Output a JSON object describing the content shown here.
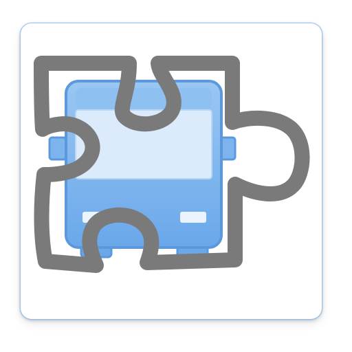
{
  "icon": {
    "name": "bus-puzzle-piece-icon",
    "colors": {
      "tile_bg": "#ffffff",
      "tile_border": "#8ec0f0",
      "bus_body": "#7db4ee",
      "bus_body_light": "#a9cdf5",
      "bus_window": "#dcebfc",
      "bus_outline": "#5b98dc",
      "puzzle_outline": "#7a7a7a",
      "headlight": "#eaf4ff"
    }
  }
}
